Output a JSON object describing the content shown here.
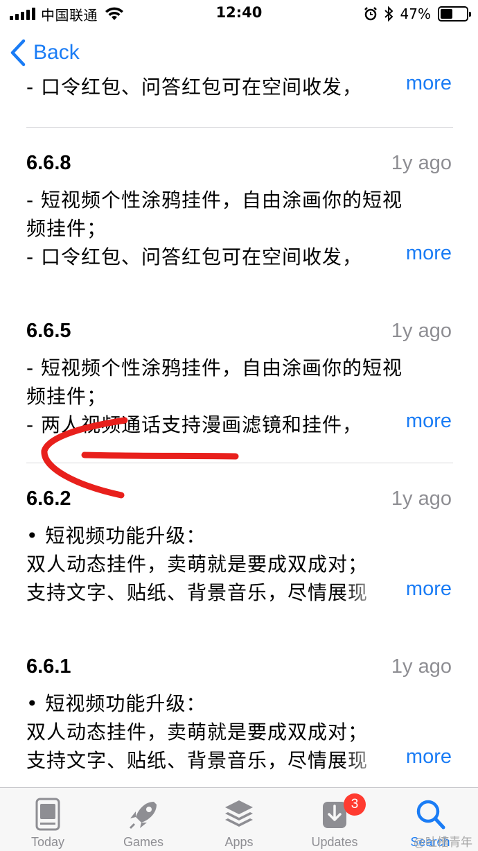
{
  "status_bar": {
    "carrier": "中国联通",
    "time": "12:40",
    "battery_percent": "47%",
    "battery_level": 0.47,
    "icons": [
      "signal-icon",
      "wifi-icon",
      "alarm-icon",
      "bluetooth-icon",
      "battery-icon"
    ]
  },
  "nav": {
    "back_label": "Back"
  },
  "top_partial": {
    "line": "- 口令红包、问答红包可在空间收发，",
    "more": "more"
  },
  "versions": [
    {
      "version": "6.6.8",
      "ago": "1y ago",
      "lines": [
        "- 短视频个性涂鸦挂件，自由涂画你的短视",
        "频挂件；",
        "- 口令红包、问答红包可在空间收发，"
      ],
      "more": "more"
    },
    {
      "version": "6.6.5",
      "ago": "1y ago",
      "lines": [
        "- 短视频个性涂鸦挂件，自由涂画你的短视",
        "频挂件；",
        "- 两人视频通话支持漫画滤镜和挂件，"
      ],
      "more": "more"
    },
    {
      "version": "6.6.2",
      "ago": "1y ago",
      "lines": [
        "• 短视频功能升级：",
        "双人动态挂件，卖萌就是要成双成对；",
        "支持文字、贴纸、背景音乐，尽情展现"
      ],
      "more": "more"
    },
    {
      "version": "6.6.1",
      "ago": "1y ago",
      "lines": [
        "• 短视频功能升级：",
        "双人动态挂件，卖萌就是要成双成对；",
        "支持文字、贴纸、背景音乐，尽情展现"
      ],
      "more": "more"
    }
  ],
  "tabbar": {
    "tabs": [
      {
        "label": "Today",
        "icon": "today-icon"
      },
      {
        "label": "Games",
        "icon": "rocket-icon"
      },
      {
        "label": "Apps",
        "icon": "layers-icon"
      },
      {
        "label": "Updates",
        "icon": "download-icon",
        "badge": "3"
      },
      {
        "label": "Search",
        "icon": "search-icon",
        "active": true
      }
    ]
  },
  "watermark": "@吐槽青年",
  "colors": {
    "accent": "#1a7cf5",
    "badge": "#ff3b30",
    "annotation": "#e8201c",
    "secondary_text": "#8e8e93"
  }
}
